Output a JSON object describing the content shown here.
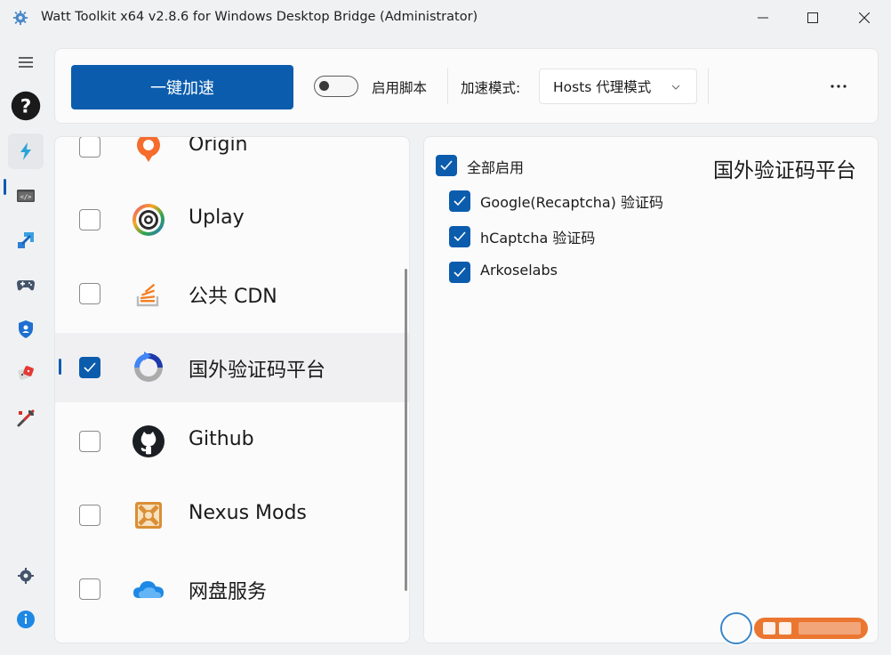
{
  "window": {
    "title": "Watt Toolkit x64 v2.8.6 for Windows Desktop Bridge (Administrator)",
    "icon": "gear-app-icon"
  },
  "nav": {
    "items": [
      {
        "name": "menu-icon"
      },
      {
        "name": "help-icon"
      },
      {
        "name": "lightning-icon",
        "active": true
      },
      {
        "name": "code-icon"
      },
      {
        "name": "transfer-icon"
      },
      {
        "name": "gamepad-icon"
      },
      {
        "name": "shield-icon"
      },
      {
        "name": "dice-icon"
      },
      {
        "name": "tools-icon"
      },
      {
        "name": "settings-icon"
      },
      {
        "name": "info-icon"
      }
    ]
  },
  "toolbar": {
    "accelerate_label": "一键加速",
    "script_toggle_label": "启用脚本",
    "script_toggle_on": false,
    "mode_label": "加速模式:",
    "mode_value": "Hosts 代理模式",
    "more_icon": "more-icon"
  },
  "services": [
    {
      "label": "Origin",
      "checked": false,
      "icon": "origin-icon"
    },
    {
      "label": "Uplay",
      "checked": false,
      "icon": "uplay-icon"
    },
    {
      "label": "公共 CDN",
      "checked": false,
      "icon": "stack-icon"
    },
    {
      "label": "国外验证码平台",
      "checked": true,
      "selected": true,
      "icon": "recaptcha-icon"
    },
    {
      "label": "Github",
      "checked": false,
      "icon": "github-icon"
    },
    {
      "label": "Nexus Mods",
      "checked": false,
      "icon": "nexus-icon"
    },
    {
      "label": "网盘服务",
      "checked": false,
      "icon": "cloud-icon"
    }
  ],
  "detail": {
    "title": "国外验证码平台",
    "enable_all_label": "全部启用",
    "enable_all_checked": true,
    "options": [
      {
        "label": "Google(Recaptcha) 验证码",
        "checked": true
      },
      {
        "label": "hCaptcha 验证码",
        "checked": true
      },
      {
        "label": "Arkoselabs",
        "checked": true
      }
    ]
  },
  "colors": {
    "accent": "#0b5cad",
    "background": "#f0f1f3",
    "card": "#fbfbfc"
  }
}
